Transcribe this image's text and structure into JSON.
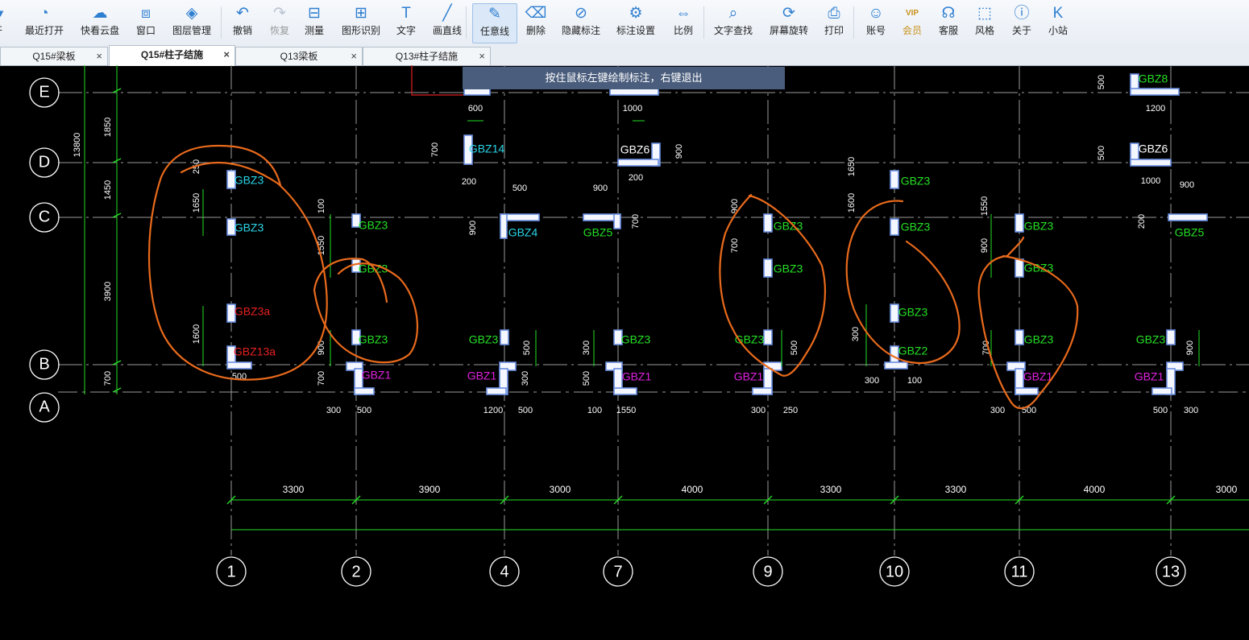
{
  "toolbar": {
    "items": [
      {
        "label": "开",
        "icon": "open-icon",
        "glyph": "▰"
      },
      {
        "label": "最近打开",
        "icon": "recent-icon",
        "glyph": "◔"
      },
      {
        "label": "快看云盘",
        "icon": "cloud-icon",
        "glyph": "☁"
      },
      {
        "label": "窗口",
        "icon": "window-icon",
        "glyph": "⧈"
      },
      {
        "label": "图层管理",
        "icon": "layers-icon",
        "glyph": "◈"
      },
      {
        "label": "撤销",
        "icon": "undo-icon",
        "glyph": "↶"
      },
      {
        "label": "恢复",
        "icon": "redo-icon",
        "glyph": "↷"
      },
      {
        "label": "测量",
        "icon": "measure-icon",
        "glyph": "⊟"
      },
      {
        "label": "图形识别",
        "icon": "shape-recognize-icon",
        "glyph": "⊞"
      },
      {
        "label": "文字",
        "icon": "text-icon",
        "glyph": "T"
      },
      {
        "label": "画直线",
        "icon": "line-icon",
        "glyph": "╱"
      },
      {
        "label": "任意线",
        "icon": "freehand-icon",
        "glyph": "✎"
      },
      {
        "label": "删除",
        "icon": "eraser-icon",
        "glyph": "⌫"
      },
      {
        "label": "隐藏标注",
        "icon": "hide-icon",
        "glyph": "⊘"
      },
      {
        "label": "标注设置",
        "icon": "settings-icon",
        "glyph": "⚙"
      },
      {
        "label": "比例",
        "icon": "scale-icon",
        "glyph": "⇔"
      },
      {
        "label": "文字查找",
        "icon": "find-text-icon",
        "glyph": "⌕"
      },
      {
        "label": "屏幕旋转",
        "icon": "rotate-icon",
        "glyph": "⟳"
      },
      {
        "label": "打印",
        "icon": "print-icon",
        "glyph": "⎙"
      },
      {
        "label": "账号",
        "icon": "user-icon",
        "glyph": "☺"
      },
      {
        "label": "会员",
        "icon": "vip-icon",
        "glyph": "VIP"
      },
      {
        "label": "客服",
        "icon": "headset-icon",
        "glyph": "☊"
      },
      {
        "label": "风格",
        "icon": "style-icon",
        "glyph": "⬚"
      },
      {
        "label": "关于",
        "icon": "info-icon",
        "glyph": "ⓘ"
      },
      {
        "label": "小站",
        "icon": "site-icon",
        "glyph": "K"
      }
    ]
  },
  "tabs": [
    {
      "label": "Q15#梁板",
      "close": "×"
    },
    {
      "label": "Q15#柱子结施",
      "close": "×"
    },
    {
      "label": "Q13梁板",
      "close": "×"
    },
    {
      "label": "Q13#柱子结施",
      "close": "×"
    }
  ],
  "hint": "按住鼠标左键绘制标注，右键退出",
  "drawing": {
    "row_axes": [
      "E",
      "D",
      "C",
      "B",
      "A"
    ],
    "col_axes": [
      "1",
      "2",
      "4",
      "7",
      "9",
      "10",
      "11",
      "13"
    ],
    "col_spacings": [
      "3300",
      "3900",
      "3000",
      "4000",
      "3300",
      "3300",
      "4000",
      "3000"
    ],
    "row_dims": [
      "13800",
      "1850",
      "1450",
      "3900",
      "700"
    ],
    "labels": [
      "GBZ3",
      "GBZ3",
      "GBZ3a",
      "GBZ13a",
      "GBZ3",
      "GBZ3",
      "GBZ3",
      "GBZ1",
      "GBZ14",
      "GBZ4",
      "GBZ3",
      "GBZ1",
      "GBZ6",
      "GBZ5",
      "GBZ3",
      "GBZ1",
      "GBZ3",
      "GBZ3",
      "GBZ3",
      "GBZ1",
      "GBZ3",
      "GBZ3",
      "GBZ3",
      "GBZ2",
      "GBZ3",
      "GBZ3",
      "GBZ3",
      "GBZ1",
      "GBZ8",
      "GBZ6",
      "GBZ5",
      "GBZ3",
      "GBZ1"
    ],
    "dims": [
      "250",
      "1650",
      "1600",
      "500",
      "100",
      "1550",
      "900",
      "700",
      "300",
      "500",
      "600",
      "700",
      "200",
      "900",
      "500",
      "500",
      "300",
      "1200",
      "500",
      "1000",
      "900",
      "200",
      "900",
      "700",
      "300",
      "500",
      "100",
      "1550",
      "900",
      "700",
      "500",
      "300",
      "250",
      "1650",
      "1600",
      "300",
      "300",
      "100",
      "1550",
      "900",
      "700",
      "300",
      "500",
      "500",
      "1200",
      "500",
      "1000",
      "900",
      "200",
      "900",
      "500",
      "300"
    ]
  }
}
